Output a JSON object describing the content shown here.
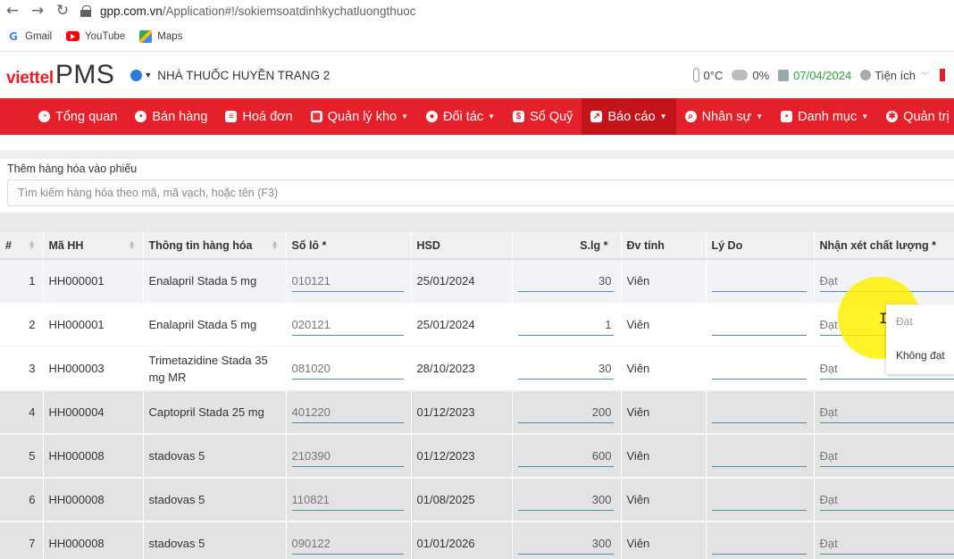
{
  "browser": {
    "url_host": "gpp.com.vn",
    "url_path": "/Application#!/sokiemsoatdinhkychatluongthuoc",
    "bookmarks": [
      {
        "label": "Gmail",
        "icon": "gmail-icon"
      },
      {
        "label": "YouTube",
        "icon": "youtube-icon"
      },
      {
        "label": "Maps",
        "icon": "maps-icon"
      }
    ]
  },
  "header": {
    "logo_brand": "viettel",
    "logo_product": "PMS",
    "store_name": "NHÀ THUỐC HUYỀN TRANG 2",
    "temperature": "0°C",
    "rain": "0%",
    "date": "07/04/2024",
    "utilities": "Tiện ích"
  },
  "nav": {
    "items": [
      {
        "label": "Tổng quan",
        "icon": "dashboard-icon",
        "dropdown": false
      },
      {
        "label": "Bán hàng",
        "icon": "location-icon",
        "dropdown": false
      },
      {
        "label": "Hoá đơn",
        "icon": "invoice-icon",
        "dropdown": false
      },
      {
        "label": "Quản lý kho",
        "icon": "warehouse-icon",
        "dropdown": true
      },
      {
        "label": "Đối tác",
        "icon": "partners-icon",
        "dropdown": true
      },
      {
        "label": "Sổ Quỹ",
        "icon": "cashbook-icon",
        "dropdown": false
      },
      {
        "label": "Báo cáo",
        "icon": "report-icon",
        "dropdown": true,
        "active": true
      },
      {
        "label": "Nhân sự",
        "icon": "staff-icon",
        "dropdown": true
      },
      {
        "label": "Danh mục",
        "icon": "category-icon",
        "dropdown": true
      },
      {
        "label": "Quản trị",
        "icon": "settings-icon",
        "dropdown": true
      }
    ]
  },
  "search": {
    "title": "Thêm hàng hóa vào phiếu",
    "placeholder": "Tìm kiếm hàng hóa theo mã, mã vạch, hoặc tên (F3)"
  },
  "table": {
    "columns": [
      "#",
      "Mã HH",
      "Thông tin hàng hóa",
      "Số lô *",
      "HSD",
      "S.lg *",
      "Đv tính",
      "Lý Do",
      "Nhận xét chất lượng *"
    ],
    "rows": [
      {
        "idx": "1",
        "code": "HH000001",
        "name": "Enalapril Stada 5 mg",
        "lot": "010121",
        "expiry": "25/01/2024",
        "qty": "30",
        "unit": "Viên",
        "reason": "",
        "quality": "Đạt"
      },
      {
        "idx": "2",
        "code": "HH000001",
        "name": "Enalapril Stada 5 mg",
        "lot": "020121",
        "expiry": "25/01/2024",
        "qty": "1",
        "unit": "Viên",
        "reason": "",
        "quality": "Đạt"
      },
      {
        "idx": "3",
        "code": "HH000003",
        "name": "Trimetazidine Stada 35 mg MR",
        "lot": "081020",
        "expiry": "28/10/2023",
        "qty": "30",
        "unit": "Viên",
        "reason": "",
        "quality": "Đạt"
      },
      {
        "idx": "4",
        "code": "HH000004",
        "name": "Captopril Stada 25 mg",
        "lot": "401220",
        "expiry": "01/12/2023",
        "qty": "200",
        "unit": "Viên",
        "reason": "",
        "quality": "Đạt"
      },
      {
        "idx": "5",
        "code": "HH000008",
        "name": "stadovas 5",
        "lot": "210390",
        "expiry": "01/12/2023",
        "qty": "600",
        "unit": "Viên",
        "reason": "",
        "quality": "Đạt"
      },
      {
        "idx": "6",
        "code": "HH000008",
        "name": "stadovas 5",
        "lot": "110821",
        "expiry": "01/08/2025",
        "qty": "300",
        "unit": "Viên",
        "reason": "",
        "quality": "Đạt"
      },
      {
        "idx": "7",
        "code": "HH000008",
        "name": "stadovas 5",
        "lot": "090122",
        "expiry": "01/01/2026",
        "qty": "300",
        "unit": "Viên",
        "reason": "",
        "quality": "Đạt"
      }
    ]
  },
  "quality_dropdown": {
    "options": [
      "Đạt",
      "Không đạt"
    ],
    "selected": "Đạt"
  }
}
